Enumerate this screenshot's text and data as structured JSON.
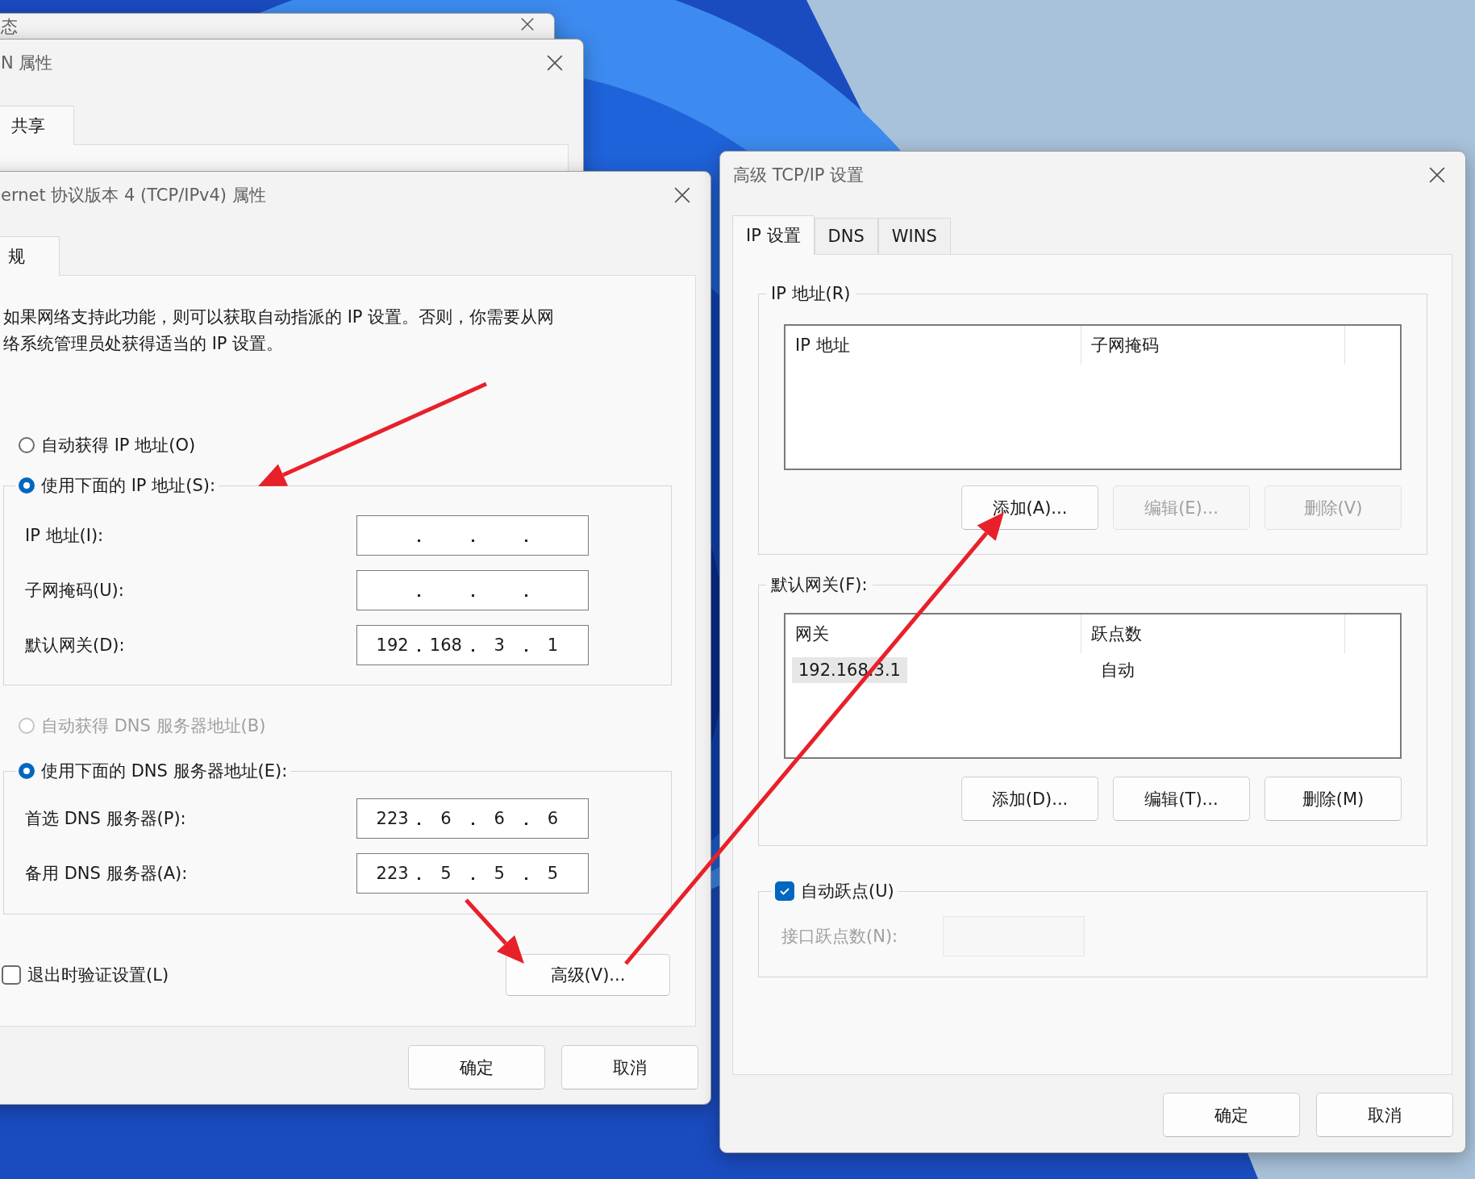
{
  "status_window": {
    "title": "态"
  },
  "properties_window": {
    "title": "N 属性",
    "tabs": [
      {
        "label": "共享",
        "selected": true
      }
    ]
  },
  "ipv4_dialog": {
    "title": "ernet 协议版本 4 (TCP/IPv4) 属性",
    "tabs": [
      {
        "label": "规",
        "selected": true
      }
    ],
    "description": "如果网络支持此功能，则可以获取自动指派的 IP 设置。否则，你需要从网络系统管理员处获得适当的 IP 设置。",
    "ip_options": [
      {
        "label": "自动获得 IP 地址(O)",
        "selected": false,
        "disabled": false
      },
      {
        "label": "使用下面的 IP 地址(S):",
        "selected": true,
        "disabled": false
      }
    ],
    "ip_fields": [
      {
        "label": "IP 地址(I):"
      },
      {
        "label": "子网掩码(U):"
      },
      {
        "label": "默认网关(D):",
        "octets": [
          "192",
          "168",
          "3",
          "1"
        ]
      }
    ],
    "dns_options": [
      {
        "label": "自动获得 DNS 服务器地址(B)",
        "selected": false,
        "disabled": true
      },
      {
        "label": "使用下面的 DNS 服务器地址(E):",
        "selected": true,
        "disabled": false
      }
    ],
    "dns_fields": [
      {
        "label": "首选 DNS 服务器(P):",
        "octets": [
          "223",
          "6",
          "6",
          "6"
        ]
      },
      {
        "label": "备用 DNS 服务器(A):",
        "octets": [
          "223",
          "5",
          "5",
          "5"
        ]
      }
    ],
    "validate_checkbox": {
      "label": "退出时验证设置(L)",
      "checked": false
    },
    "advanced_button": "高级(V)...",
    "buttons": [
      "确定",
      "取消"
    ]
  },
  "advanced_dialog": {
    "title": "高级 TCP/IP 设置",
    "tabs": [
      {
        "label": "IP 设置",
        "selected": true
      },
      {
        "label": "DNS",
        "selected": false
      },
      {
        "label": "WINS",
        "selected": false
      }
    ],
    "groups": [
      {
        "legend": "IP 地址(R)",
        "columns": [
          "IP 地址",
          "子网掩码"
        ],
        "buttons": [
          {
            "label": "添加(A)...",
            "disabled": false
          },
          {
            "label": "编辑(E)...",
            "disabled": true
          },
          {
            "label": "删除(V)",
            "disabled": true
          }
        ]
      },
      {
        "legend": "默认网关(F):",
        "columns": [
          "网关",
          "跃点数"
        ],
        "rows": [
          {
            "cells": [
              "192.168.3.1",
              "自动"
            ],
            "selected": true
          }
        ],
        "buttons": [
          {
            "label": "添加(D)...",
            "disabled": false
          },
          {
            "label": "编辑(T)...",
            "disabled": false
          },
          {
            "label": "删除(M)",
            "disabled": false
          }
        ]
      }
    ],
    "auto_metric": {
      "label": "自动跃点(U)",
      "checked": true
    },
    "interface_metric": {
      "label": "接口跃点数(N):",
      "disabled": true
    },
    "buttons": [
      "确定",
      "取消"
    ]
  }
}
